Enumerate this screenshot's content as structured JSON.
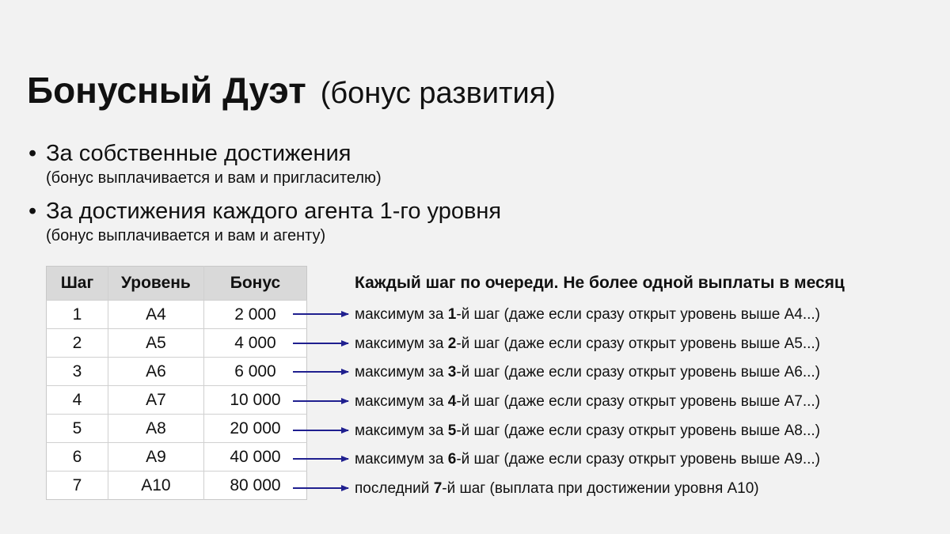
{
  "title": {
    "main": "Бонусный Дуэт",
    "sub": "(бонус развития)"
  },
  "bullets": [
    {
      "text": "За собственные достижения",
      "note": "(бонус выплачивается и вам и пригласителю)"
    },
    {
      "text": "За достижения каждого агента 1-го уровня",
      "note": "(бонус выплачивается и вам и агенту)"
    }
  ],
  "bullet_symbol": "•",
  "table": {
    "headers": [
      "Шаг",
      "Уровень",
      "Бонус"
    ],
    "rows": [
      [
        "1",
        "А4",
        "2 000"
      ],
      [
        "2",
        "А5",
        "4 000"
      ],
      [
        "3",
        "А6",
        "6 000"
      ],
      [
        "4",
        "А7",
        "10 000"
      ],
      [
        "5",
        "А8",
        "20 000"
      ],
      [
        "6",
        "А9",
        "40 000"
      ],
      [
        "7",
        "А10",
        "80 000"
      ]
    ]
  },
  "rules": {
    "heading": "Каждый шаг по очереди. Не более одной выплаты в месяц",
    "items": [
      {
        "prefix": "максимум за ",
        "step": "1",
        "suffix": "-й шаг (даже если сразу открыт уровень выше А4...)"
      },
      {
        "prefix": "максимум за ",
        "step": "2",
        "suffix": "-й шаг (даже если сразу открыт уровень выше А5...)"
      },
      {
        "prefix": "максимум за ",
        "step": "3",
        "suffix": "-й шаг (даже если сразу открыт уровень выше А6...)"
      },
      {
        "prefix": "максимум за ",
        "step": "4",
        "suffix": "-й шаг (даже если сразу открыт уровень выше А7...)"
      },
      {
        "prefix": "максимум за ",
        "step": "5",
        "suffix": "-й шаг (даже если сразу открыт уровень выше А8...)"
      },
      {
        "prefix": "максимум за ",
        "step": "6",
        "suffix": "-й шаг (даже если сразу открыт уровень выше А9...)"
      },
      {
        "prefix": "последний ",
        "step": "7",
        "suffix": "-й шаг (выплата при достижении уровня А10)"
      }
    ]
  },
  "colors": {
    "background": "#f2f2f2",
    "arrow": "#1f1f8f",
    "table_header": "#d9d9d9"
  }
}
